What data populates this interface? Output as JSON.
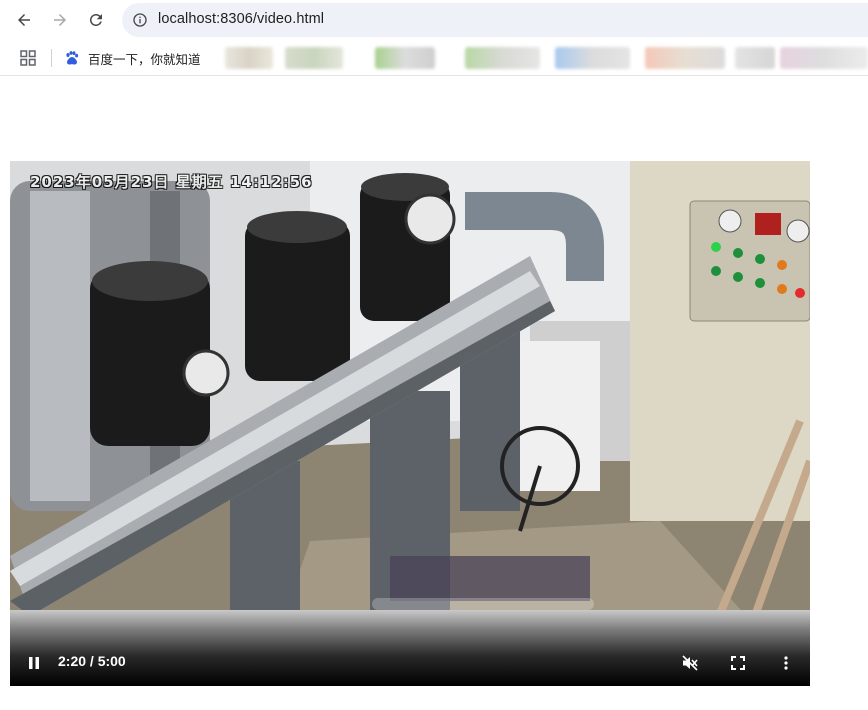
{
  "browser": {
    "url": "localhost:8306/video.html",
    "icons": {
      "back": "arrow-left-icon",
      "forward": "arrow-right-icon",
      "reload": "reload-icon",
      "site_info": "site-info-icon",
      "apps": "apps-grid-icon"
    }
  },
  "bookmarks": {
    "items": [
      {
        "label": "百度一下，你就知道",
        "icon": "baidu-paw-icon"
      }
    ]
  },
  "video": {
    "osd_text": "2023年05月23日 星期五 14:12:56",
    "time_display": "2:20 / 5:00",
    "progress_fraction": 0.467,
    "state": "playing",
    "muted": true,
    "controls": {
      "play_pause": "pause-icon",
      "mute": "muted-speaker-icon",
      "fullscreen": "fullscreen-icon",
      "more": "more-vertical-icon"
    }
  },
  "colors": {
    "omnibox_bg": "#eef1f8",
    "baidu_blue": "#2f5fe0"
  }
}
